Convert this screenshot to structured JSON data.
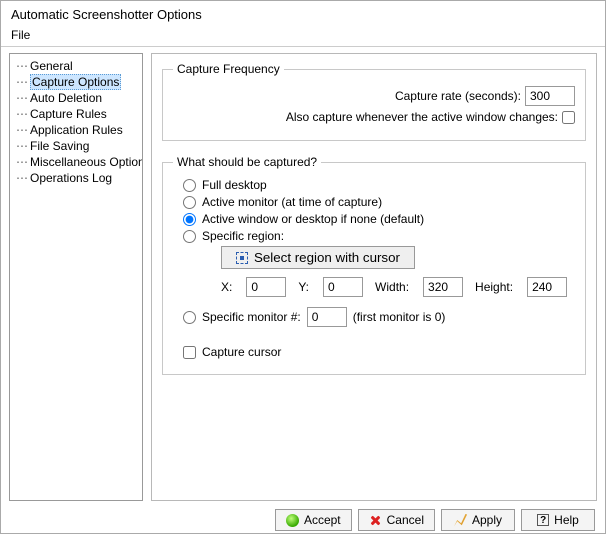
{
  "title": "Automatic Screenshotter Options",
  "menubar": {
    "file": "File"
  },
  "tree": {
    "items": [
      "General",
      "Capture Options",
      "Auto Deletion",
      "Capture Rules",
      "Application Rules",
      "File Saving",
      "Miscellaneous Options",
      "Operations Log"
    ],
    "selected_index": 1
  },
  "freq": {
    "legend": "Capture Frequency",
    "rate_label": "Capture rate (seconds):",
    "rate_value": "300",
    "active_change_label": "Also capture whenever the active window changes:",
    "active_change_checked": false
  },
  "what": {
    "legend": "What should be captured?",
    "options": {
      "full_desktop": "Full desktop",
      "active_monitor": "Active monitor (at time of capture)",
      "active_window": "Active window or desktop if none (default)",
      "specific_region": "Specific region:",
      "specific_monitor": "Specific monitor #:"
    },
    "selected": "active_window",
    "region_button": "Select region with cursor",
    "coords": {
      "x_label": "X:",
      "x": "0",
      "y_label": "Y:",
      "y": "0",
      "w_label": "Width:",
      "w": "320",
      "h_label": "Height:",
      "h": "240"
    },
    "monitor_value": "0",
    "monitor_hint": "(first monitor is 0)",
    "capture_cursor_label": "Capture cursor",
    "capture_cursor_checked": false
  },
  "buttons": {
    "accept": "Accept",
    "cancel": "Cancel",
    "apply": "Apply",
    "help": "Help"
  }
}
